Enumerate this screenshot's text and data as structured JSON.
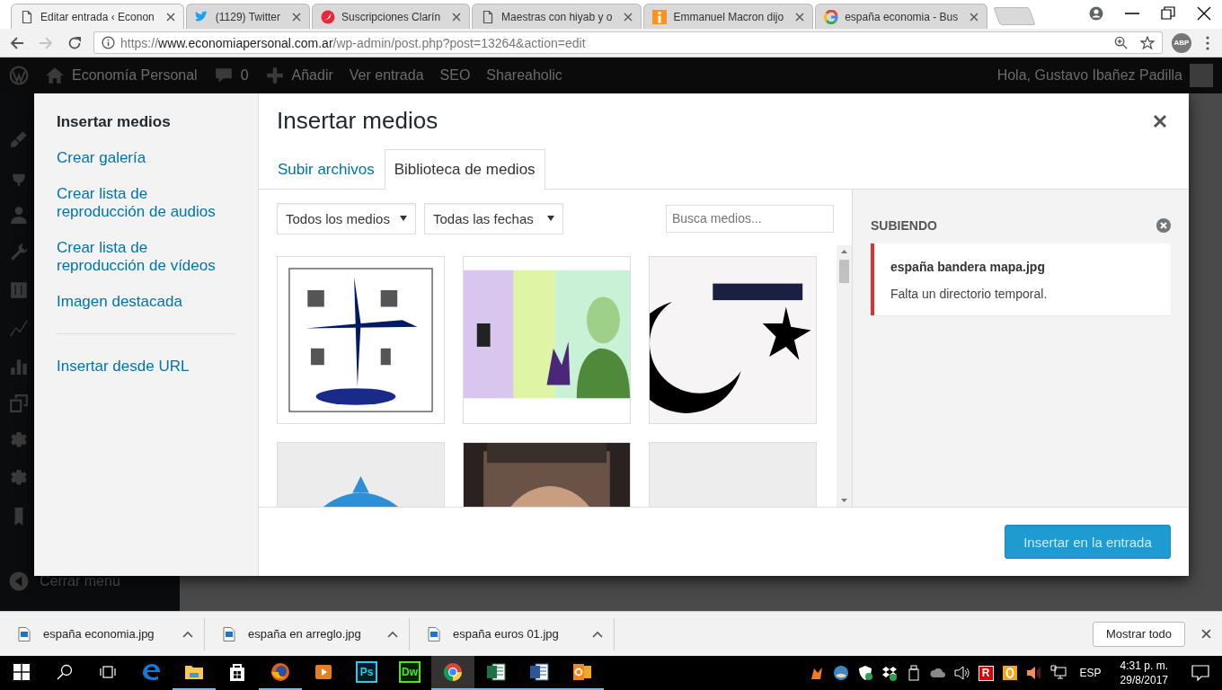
{
  "browser": {
    "tabs": [
      {
        "title": "Editar entrada ‹ Econon",
        "selected": true
      },
      {
        "title": "(1129) Twitter",
        "selected": false
      },
      {
        "title": "Suscripciones Clarín",
        "selected": false
      },
      {
        "title": "Maestras con hiyab y o",
        "selected": false
      },
      {
        "title": "Emmanuel Macron dijo",
        "selected": false
      },
      {
        "title": "españa economia - Bus",
        "selected": false
      }
    ],
    "address": {
      "scheme": "https://",
      "host": "www.economiapersonal.com.ar",
      "path": "/wp-admin/post.php?post=13264&action=edit"
    },
    "extension_label": "ABP"
  },
  "admin_bar": {
    "site": "Economía Personal",
    "comments": "0",
    "items": [
      "Añadir",
      "Ver entrada",
      "SEO",
      "Shareaholic"
    ],
    "greeting": "Hola, Gustavo Ibañez Padilla"
  },
  "admin_menu": {
    "collapse_label": "Cerrar menú"
  },
  "media_modal": {
    "menu_groups": [
      [
        {
          "label": "Insertar medios",
          "selected": true
        },
        {
          "label": "Crear galería",
          "selected": false
        },
        {
          "label": "Crear lista de reproducción de audios",
          "selected": false
        },
        {
          "label": "Crear lista de reproducción de vídeos",
          "selected": false
        },
        {
          "label": "Imagen destacada",
          "selected": false
        }
      ],
      [
        {
          "label": "Insertar desde URL",
          "selected": false
        }
      ]
    ],
    "title": "Insertar medios",
    "tabs": [
      {
        "label": "Subir archivos",
        "selected": false
      },
      {
        "label": "Biblioteca de medios",
        "selected": true
      }
    ],
    "filters": [
      {
        "value": "Todos los medios"
      },
      {
        "value": "Todas las fechas"
      }
    ],
    "search": {
      "placeholder": "Busca medios..."
    },
    "attachments": [
      {
        "kind": "picture"
      },
      {
        "kind": "picture"
      },
      {
        "kind": "picture"
      },
      {
        "kind": "picture"
      },
      {
        "kind": "picture"
      },
      {
        "kind": "picture"
      }
    ],
    "uploads": {
      "heading": "SUBIENDO",
      "items": [
        {
          "file": "españa bandera mapa.jpg",
          "message": "Falta un directorio temporal."
        }
      ]
    },
    "primary_button": "Insertar en la entrada"
  },
  "downloads": {
    "items": [
      {
        "file": "españa economia.jpg"
      },
      {
        "file": "españa en arreglo.jpg"
      },
      {
        "file": "españa euros 01.jpg"
      }
    ],
    "show_all": "Mostrar todo"
  },
  "taskbar": {
    "apps": [
      {
        "kind": "edge",
        "running": false,
        "selected": false
      },
      {
        "kind": "folder",
        "running": true,
        "selected": false
      },
      {
        "kind": "store",
        "running": false,
        "selected": false
      },
      {
        "kind": "firefox",
        "running": true,
        "selected": false
      },
      {
        "kind": "player",
        "running": false,
        "selected": false
      },
      {
        "kind": "ps",
        "label": "Ps",
        "running": false,
        "selected": false
      },
      {
        "kind": "dw",
        "label": "Dw",
        "running": false,
        "selected": false
      },
      {
        "kind": "chrome",
        "running": true,
        "selected": true
      },
      {
        "kind": "excel",
        "running": true,
        "selected": false
      },
      {
        "kind": "word",
        "running": true,
        "selected": false
      },
      {
        "kind": "outlook",
        "running": true,
        "selected": false
      }
    ],
    "tray_badge": "R",
    "language": "ESP",
    "time": "4:31 p. m.",
    "date": "29/8/2017"
  }
}
